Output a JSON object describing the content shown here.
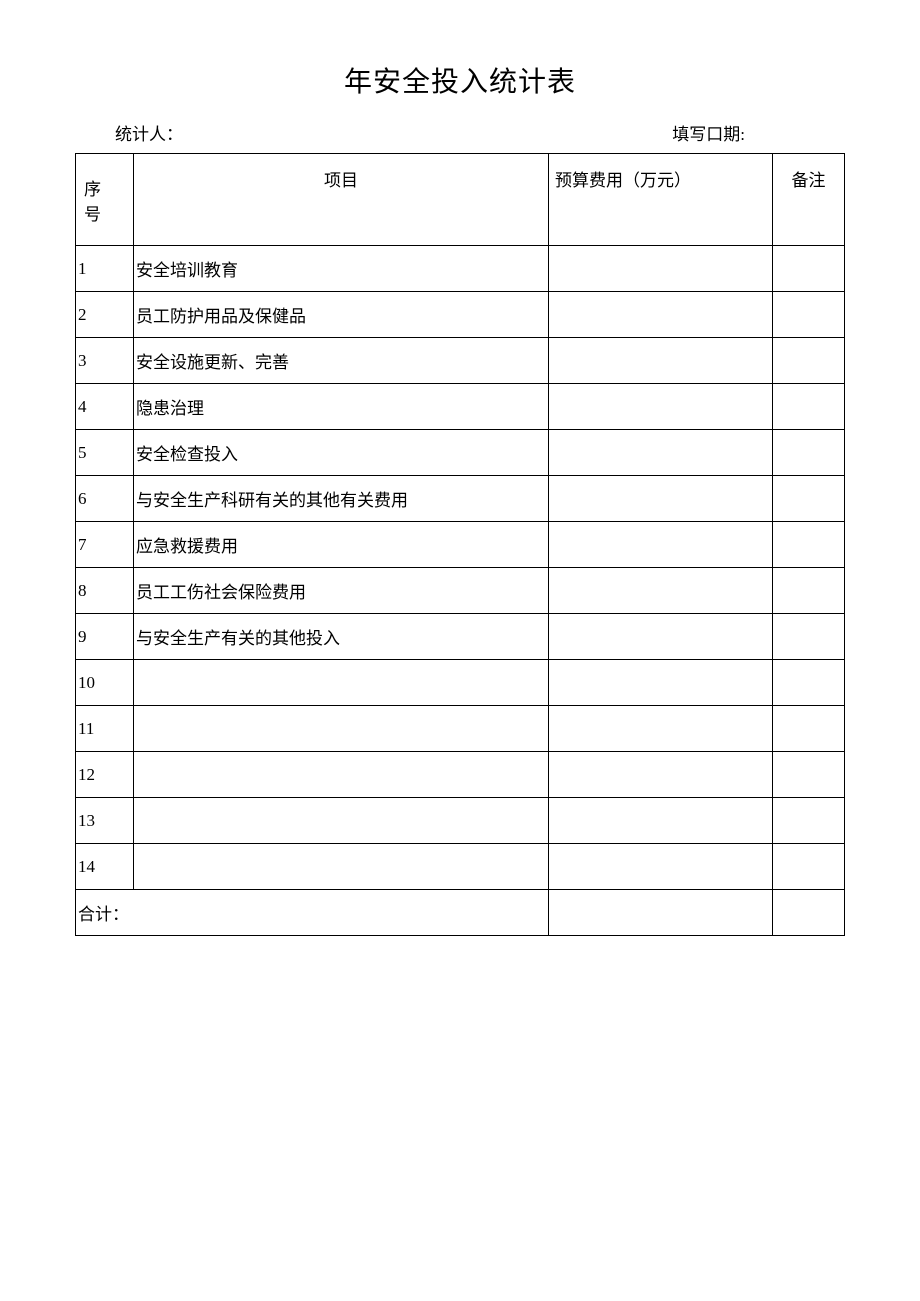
{
  "title": "年安全投入统计表",
  "meta": {
    "stat_person_label": "统计人：",
    "fill_date_label": "填写口期:"
  },
  "headers": {
    "seq": "序 号",
    "item": "项目",
    "budget": "预算费用（万元）",
    "remark": "备注"
  },
  "rows": [
    {
      "seq": "1",
      "item": "安全培训教育",
      "budget": "",
      "remark": ""
    },
    {
      "seq": "2",
      "item": "员工防护用品及保健品",
      "budget": "",
      "remark": ""
    },
    {
      "seq": "3",
      "item": "安全设施更新、完善",
      "budget": "",
      "remark": ""
    },
    {
      "seq": "4",
      "item": "隐患治理",
      "budget": "",
      "remark": ""
    },
    {
      "seq": "5",
      "item": "安全检查投入",
      "budget": "",
      "remark": ""
    },
    {
      "seq": "6",
      "item": "与安全生产科研有关的其他有关费用",
      "budget": "",
      "remark": ""
    },
    {
      "seq": "7",
      "item": "应急救援费用",
      "budget": "",
      "remark": ""
    },
    {
      "seq": "8",
      "item": "员工工伤社会保险费用",
      "budget": "",
      "remark": ""
    },
    {
      "seq": "9",
      "item": "与安全生产有关的其他投入",
      "budget": "",
      "remark": ""
    },
    {
      "seq": "10",
      "item": "",
      "budget": "",
      "remark": ""
    },
    {
      "seq": "11",
      "item": "",
      "budget": "",
      "remark": ""
    },
    {
      "seq": "12",
      "item": "",
      "budget": "",
      "remark": ""
    },
    {
      "seq": "13",
      "item": "",
      "budget": "",
      "remark": ""
    },
    {
      "seq": "14",
      "item": "",
      "budget": "",
      "remark": ""
    }
  ],
  "total": {
    "label": "合计：",
    "budget": "",
    "remark": ""
  }
}
